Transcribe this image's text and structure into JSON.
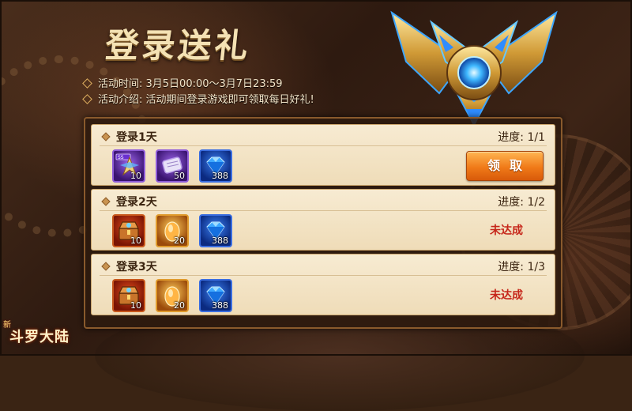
{
  "title": "登录送礼",
  "info": [
    {
      "label": "活动时间: 3月5日00:00～3月7日23:59"
    },
    {
      "label": "活动介绍: 活动期间登录游戏即可领取每日好礼!"
    }
  ],
  "rows": [
    {
      "title": "登录1天",
      "progress": "进度: 1/1",
      "items": [
        {
          "icon": "ss-soul-ring-icon",
          "count": "10"
        },
        {
          "icon": "scroll-icon",
          "count": "50"
        },
        {
          "icon": "blue-diamond-icon",
          "count": "388"
        }
      ],
      "action": {
        "type": "button",
        "label": "领取"
      }
    },
    {
      "title": "登录2天",
      "progress": "进度: 1/2",
      "items": [
        {
          "icon": "treasure-chest-icon",
          "count": "10"
        },
        {
          "icon": "gold-crystal-icon",
          "count": "20"
        },
        {
          "icon": "blue-diamond-icon",
          "count": "388"
        }
      ],
      "action": {
        "type": "status",
        "label": "未达成"
      }
    },
    {
      "title": "登录3天",
      "progress": "进度: 1/3",
      "items": [
        {
          "icon": "treasure-chest-icon",
          "count": "10"
        },
        {
          "icon": "gold-crystal-icon",
          "count": "20"
        },
        {
          "icon": "blue-diamond-icon",
          "count": "388"
        }
      ],
      "action": {
        "type": "status",
        "label": "未达成"
      }
    }
  ],
  "logo": {
    "new_tag": "新",
    "name": "斗罗大陆"
  },
  "colors": {
    "claim_button": "#f07a18",
    "incomplete_status": "#c6261a",
    "row_bg": "#f7ebd2"
  }
}
